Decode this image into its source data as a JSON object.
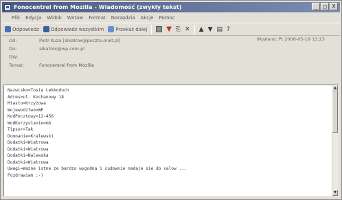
{
  "window": {
    "title": "Fonocentrel from Mozilla - Wiadomość (zwykły tekst)",
    "controls": [
      "_",
      "□",
      "X"
    ]
  },
  "menu": [
    "Plik",
    "Edycja",
    "Widok",
    "Wstaw",
    "Format",
    "Narzędzia",
    "Akcje",
    "Pomoc"
  ],
  "toolbar": {
    "reply": "Odpowiedz",
    "reply_all": "Odpowiedz wszystkim",
    "forward": "Przekaż dalej"
  },
  "headers": {
    "from_label": "Od:",
    "from_value": "Piotr Kuza [alkatrox@poczta.onet.pl]",
    "sent_label": "Wysłano:",
    "sent_value": "Pt 2006-05-19 13:23",
    "to_label": "Do:",
    "to_value": "alkatrox@wp.com.pl",
    "cc_label": "DW:",
    "cc_value": "",
    "subject_label": "Temat:",
    "subject_value": "Fonocentrel from Mozilla"
  },
  "body": {
    "lines": [
      "Nazwisko=Tosia Lekkoduch",
      "Adres=ul. Kochanowy 18",
      "Miasto=Krzyżowa",
      "Wojewodztwo=WP",
      "KodPocztowy=12-456",
      "WodKorzystanie=mb",
      "Tipsor=Tak",
      "Domnanie=Kralewski",
      "Dodatki=Wiatrowa",
      "Dodatki=Wiatrowa",
      "Dodatki=Nalewska",
      "Dodatki=Wiatrowa",
      "Uwagi=Wazne istne ze bardzo wygodna i cudownie nadaje sie do celow ...",
      "Pozdrawiam :-)"
    ]
  }
}
